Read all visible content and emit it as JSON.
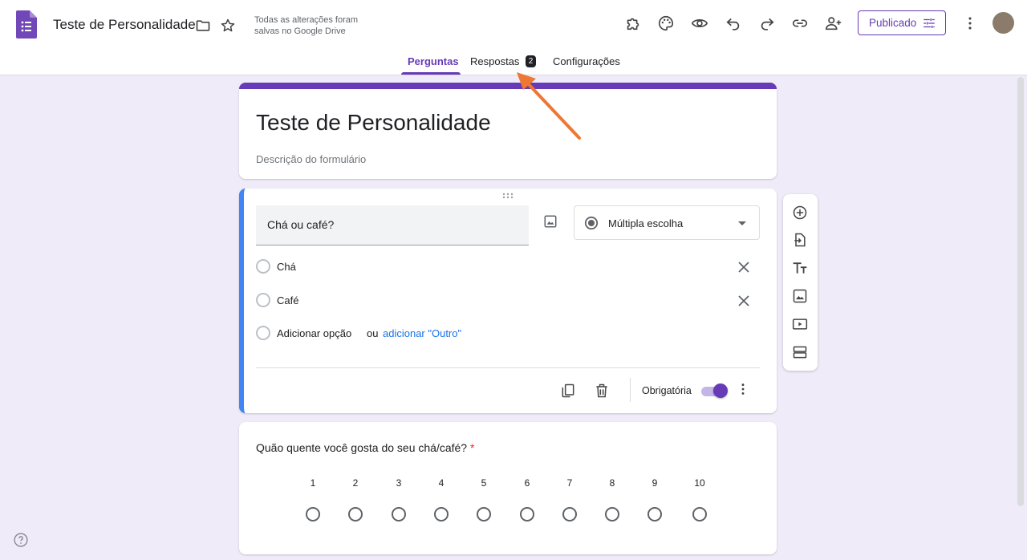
{
  "header": {
    "doc_title": "Teste de Personalidade",
    "save_status": "Todas as alterações foram salvas no Google Drive",
    "publish_label": "Publicado"
  },
  "tabs": [
    {
      "label": "Perguntas"
    },
    {
      "label": "Respostas",
      "badge": "2"
    },
    {
      "label": "Configurações"
    }
  ],
  "form": {
    "title": "Teste de Personalidade",
    "description": "Descrição do formulário"
  },
  "question1": {
    "text": "Chá ou café?",
    "type": "Múltipla escolha",
    "options": [
      {
        "label": "Chá"
      },
      {
        "label": "Café"
      }
    ],
    "add_option": "Adicionar opção",
    "or_text": "ou",
    "add_other": "adicionar \"Outro\"",
    "required_label": "Obrigatória",
    "required": true
  },
  "question2": {
    "text": "Quão quente você gosta do seu chá/café?",
    "required_mark": "*",
    "scale": [
      "1",
      "2",
      "3",
      "4",
      "5",
      "6",
      "7",
      "8",
      "9",
      "10"
    ]
  },
  "colors": {
    "accent": "#673ab7",
    "active_border": "#4285f4",
    "background": "#f0ebf8",
    "link": "#1a73e8",
    "annotation_arrow": "#ee7733"
  }
}
